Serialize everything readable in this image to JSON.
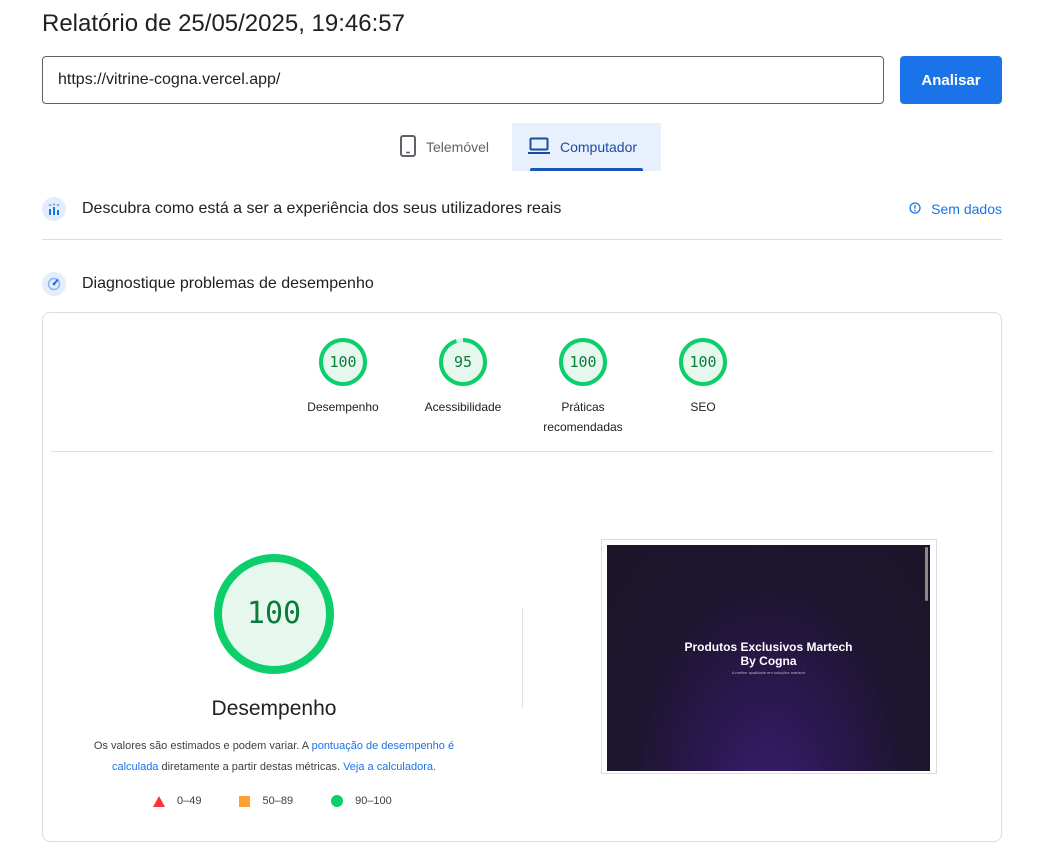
{
  "header": {
    "title": "Relatório de 25/05/2025, 19:46:57"
  },
  "url_input": {
    "value": "https://vitrine-cogna.vercel.app/"
  },
  "analyze_button": {
    "label": "Analisar"
  },
  "tabs": [
    {
      "label": "Telemóvel",
      "icon": "smartphone-icon",
      "selected": false
    },
    {
      "label": "Computador",
      "icon": "laptop-icon",
      "selected": true
    }
  ],
  "field_data": {
    "title": "Descubra como está a ser a experiência dos seus utilizadores reais",
    "status": "Sem dados",
    "icon": "field-data-icon",
    "status_icon": "info-icon"
  },
  "lab_data": {
    "title": "Diagnostique problemas de desempenho",
    "icon": "speed-gauge-icon"
  },
  "scores": [
    {
      "label": "Desempenho",
      "value": "100",
      "fraction": 1.0
    },
    {
      "label": "Acessibilidade",
      "value": "95",
      "fraction": 0.95
    },
    {
      "label": "Práticas recomendadas",
      "value": "100",
      "fraction": 1.0
    },
    {
      "label": "SEO",
      "value": "100",
      "fraction": 1.0
    }
  ],
  "performance": {
    "value": "100",
    "label": "Desempenho",
    "note_part1": "Os valores são estimados e podem variar. A ",
    "note_link1": "pontuação de desempenho é calculada",
    "note_part2": " diretamente a partir destas métricas. ",
    "note_link2": "Veja a calculadora."
  },
  "legend": [
    {
      "range": "0–49",
      "shape": "triangle",
      "color": "#ff3333"
    },
    {
      "range": "50–89",
      "shape": "square",
      "color": "#ffa033"
    },
    {
      "range": "90–100",
      "shape": "circle",
      "color": "#0cce6b"
    }
  ],
  "screenshot": {
    "title_line1": "Produtos Exclusivos Martech",
    "title_line2": "By Cogna",
    "subtitle": "A melhor qualidade em soluções martech"
  },
  "colors": {
    "good": "#0cce6b",
    "good_fill": "#e6f8ee",
    "good_text": "#0b7b3a",
    "accent": "#1a73e8"
  }
}
